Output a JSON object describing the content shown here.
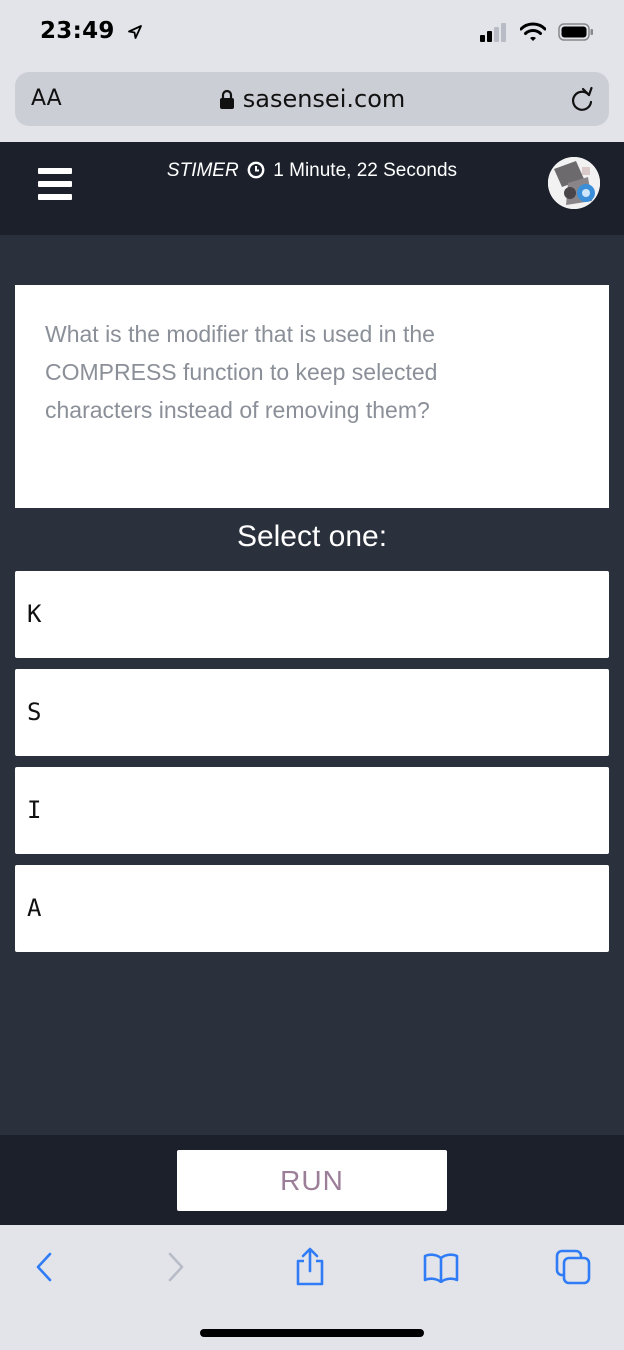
{
  "status_bar": {
    "time": "23:49"
  },
  "browser": {
    "text_size_label": "AA",
    "url": "sasensei.com"
  },
  "navbar": {
    "timer_label": "STIMER",
    "timer_value": "1 Minute, 22 Seconds"
  },
  "question": {
    "text": "What is the modifier that is used in the COMPRESS function to keep selected characters instead of removing them?"
  },
  "select_prompt": "Select one:",
  "options": [
    {
      "label": "K"
    },
    {
      "label": "S"
    },
    {
      "label": "I"
    },
    {
      "label": "A"
    }
  ],
  "run_button": "RUN",
  "colors": {
    "page_bg": "#2a303c",
    "navbar_bg": "#1b202b",
    "accent_blue": "#2f7cf6",
    "run_text": "#9b7e98"
  }
}
